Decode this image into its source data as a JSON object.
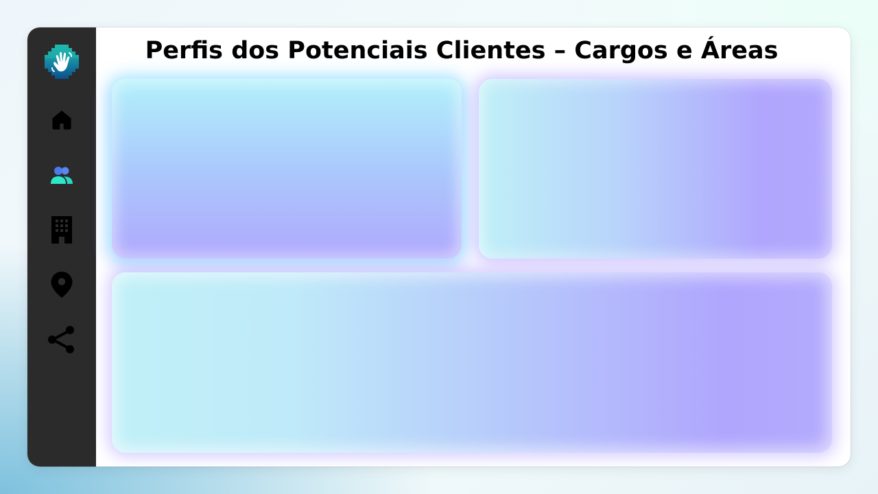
{
  "header": {
    "title": "Perfis dos Potenciais Clientes – Cargos e Áreas"
  },
  "sidebar": {
    "logo_icon": "waving-hand-icon",
    "items": [
      {
        "icon": "home-icon",
        "active": false
      },
      {
        "icon": "users-icon",
        "active": true
      },
      {
        "icon": "building-icon",
        "active": false
      },
      {
        "icon": "location-pin-icon",
        "active": false
      },
      {
        "icon": "share-icon",
        "active": false
      }
    ]
  },
  "colors": {
    "sidebar_bg": "#2b2b2b",
    "active_blue": "#4a7bec",
    "active_teal": "#2ee6c8",
    "logo_teal": "#1aa6b7",
    "logo_dark": "#0b5f8c",
    "icon_default": "#000000"
  },
  "cards": [
    {
      "id": "card-top-left"
    },
    {
      "id": "card-top-right"
    },
    {
      "id": "card-bottom"
    }
  ]
}
